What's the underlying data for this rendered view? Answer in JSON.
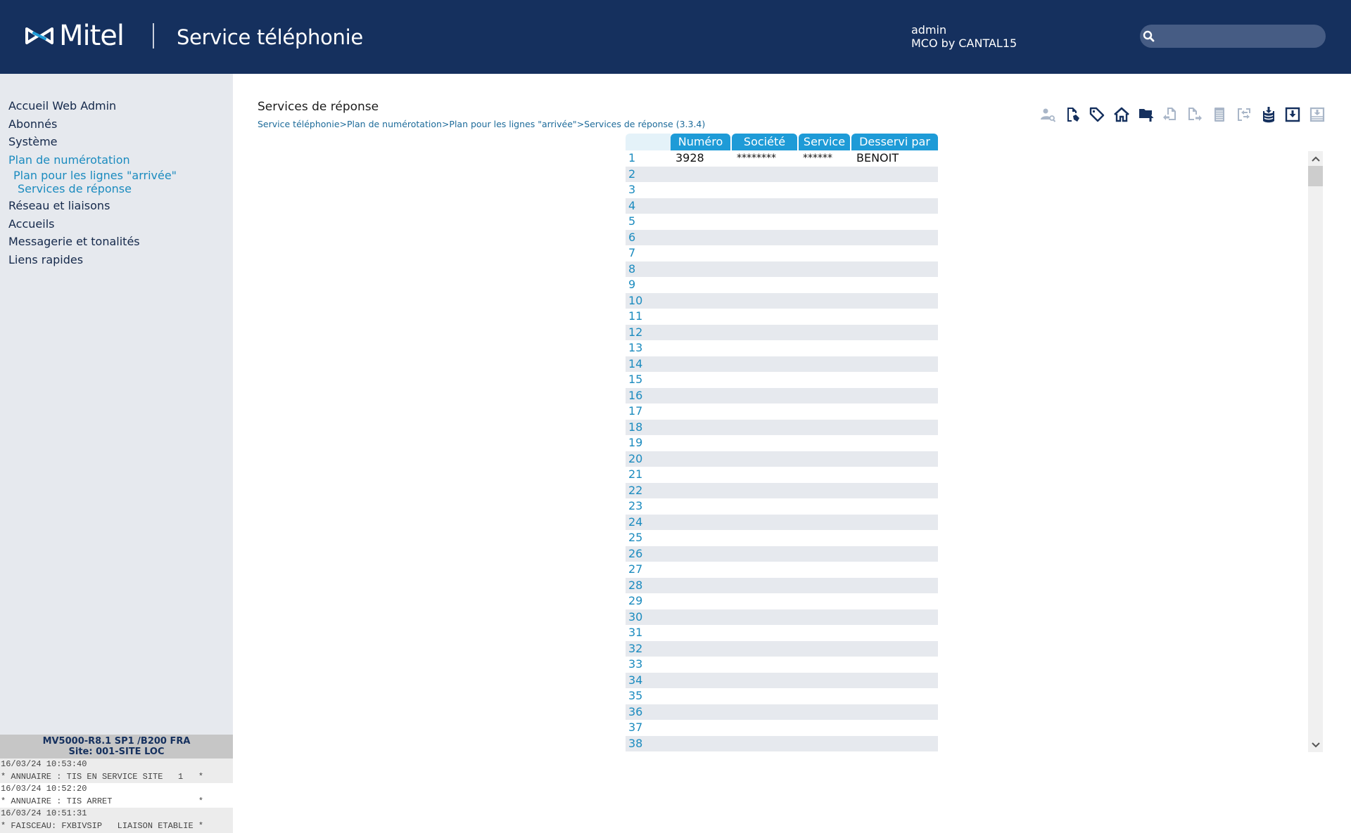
{
  "header": {
    "logo_text": "Mitel",
    "app_title": "Service téléphonie",
    "user_name": "admin",
    "user_org": "MCO by CANTAL15",
    "search_placeholder": "",
    "search_value": ""
  },
  "sidebar": {
    "items": [
      {
        "label": "Accueil Web Admin",
        "level": 0,
        "active": false
      },
      {
        "label": "Abonnés",
        "level": 0,
        "active": false
      },
      {
        "label": "Système",
        "level": 0,
        "active": false
      },
      {
        "label": "Plan de numérotation",
        "level": 0,
        "active": true
      },
      {
        "label": "Plan pour les lignes \"arrivée\"",
        "level": 1,
        "active": true
      },
      {
        "label": "Services de réponse",
        "level": 2,
        "active": true
      },
      {
        "label": "Réseau et liaisons",
        "level": 0,
        "active": false
      },
      {
        "label": "Accueils",
        "level": 0,
        "active": false
      },
      {
        "label": "Messagerie et tonalités",
        "level": 0,
        "active": false
      },
      {
        "label": "Liens rapides",
        "level": 0,
        "active": false
      }
    ],
    "status": {
      "version": "MV5000-R8.1 SP1 /B200 FRA",
      "site": "Site: 001-SITE LOC",
      "log": [
        "16/03/24 10:53:40",
        "* ANNUAIRE : TIS EN SERVICE SITE   1   *",
        "16/03/24 10:52:20",
        "* ANNUAIRE : TIS ARRET                 *",
        "16/03/24 10:51:31",
        "* FAISCEAU: FXBIVSIP   LIAISON ETABLIE *"
      ]
    }
  },
  "main": {
    "title": "Services de réponse",
    "breadcrumb": [
      "Service téléphonie",
      "Plan de numérotation",
      "Plan pour les lignes \"arrivée\"",
      "Services de réponse (3.3.4)"
    ],
    "breadcrumb_separator": ">",
    "toolbar": [
      {
        "icon": "user-search-icon",
        "enabled": false
      },
      {
        "icon": "document-edit-icon",
        "enabled": true
      },
      {
        "icon": "tag-icon",
        "enabled": true
      },
      {
        "icon": "home-icon",
        "enabled": true
      },
      {
        "icon": "folder-upload-icon",
        "enabled": true
      },
      {
        "icon": "document-import-icon",
        "enabled": false
      },
      {
        "icon": "document-export-icon",
        "enabled": false
      },
      {
        "icon": "list-icon",
        "enabled": false
      },
      {
        "icon": "swap-icon",
        "enabled": false
      },
      {
        "icon": "database-download-icon",
        "enabled": true
      },
      {
        "icon": "save-download-icon",
        "enabled": true
      },
      {
        "icon": "save-disabled-icon",
        "enabled": false
      }
    ],
    "table": {
      "columns": [
        "",
        "Numéro",
        "Société",
        "Service",
        "Desservi par"
      ],
      "rows": [
        {
          "index": "1",
          "numero": "3928",
          "societe": "********",
          "service": "******",
          "desservi": "BENOIT"
        },
        {
          "index": "2",
          "numero": "",
          "societe": "",
          "service": "",
          "desservi": ""
        },
        {
          "index": "3",
          "numero": "",
          "societe": "",
          "service": "",
          "desservi": ""
        },
        {
          "index": "4",
          "numero": "",
          "societe": "",
          "service": "",
          "desservi": ""
        },
        {
          "index": "5",
          "numero": "",
          "societe": "",
          "service": "",
          "desservi": ""
        },
        {
          "index": "6",
          "numero": "",
          "societe": "",
          "service": "",
          "desservi": ""
        },
        {
          "index": "7",
          "numero": "",
          "societe": "",
          "service": "",
          "desservi": ""
        },
        {
          "index": "8",
          "numero": "",
          "societe": "",
          "service": "",
          "desservi": ""
        },
        {
          "index": "9",
          "numero": "",
          "societe": "",
          "service": "",
          "desservi": ""
        },
        {
          "index": "10",
          "numero": "",
          "societe": "",
          "service": "",
          "desservi": ""
        },
        {
          "index": "11",
          "numero": "",
          "societe": "",
          "service": "",
          "desservi": ""
        },
        {
          "index": "12",
          "numero": "",
          "societe": "",
          "service": "",
          "desservi": ""
        },
        {
          "index": "13",
          "numero": "",
          "societe": "",
          "service": "",
          "desservi": ""
        },
        {
          "index": "14",
          "numero": "",
          "societe": "",
          "service": "",
          "desservi": ""
        },
        {
          "index": "15",
          "numero": "",
          "societe": "",
          "service": "",
          "desservi": ""
        },
        {
          "index": "16",
          "numero": "",
          "societe": "",
          "service": "",
          "desservi": ""
        },
        {
          "index": "17",
          "numero": "",
          "societe": "",
          "service": "",
          "desservi": ""
        },
        {
          "index": "18",
          "numero": "",
          "societe": "",
          "service": "",
          "desservi": ""
        },
        {
          "index": "19",
          "numero": "",
          "societe": "",
          "service": "",
          "desservi": ""
        },
        {
          "index": "20",
          "numero": "",
          "societe": "",
          "service": "",
          "desservi": ""
        },
        {
          "index": "21",
          "numero": "",
          "societe": "",
          "service": "",
          "desservi": ""
        },
        {
          "index": "22",
          "numero": "",
          "societe": "",
          "service": "",
          "desservi": ""
        },
        {
          "index": "23",
          "numero": "",
          "societe": "",
          "service": "",
          "desservi": ""
        },
        {
          "index": "24",
          "numero": "",
          "societe": "",
          "service": "",
          "desservi": ""
        },
        {
          "index": "25",
          "numero": "",
          "societe": "",
          "service": "",
          "desservi": ""
        },
        {
          "index": "26",
          "numero": "",
          "societe": "",
          "service": "",
          "desservi": ""
        },
        {
          "index": "27",
          "numero": "",
          "societe": "",
          "service": "",
          "desservi": ""
        },
        {
          "index": "28",
          "numero": "",
          "societe": "",
          "service": "",
          "desservi": ""
        },
        {
          "index": "29",
          "numero": "",
          "societe": "",
          "service": "",
          "desservi": ""
        },
        {
          "index": "30",
          "numero": "",
          "societe": "",
          "service": "",
          "desservi": ""
        },
        {
          "index": "31",
          "numero": "",
          "societe": "",
          "service": "",
          "desservi": ""
        },
        {
          "index": "32",
          "numero": "",
          "societe": "",
          "service": "",
          "desservi": ""
        },
        {
          "index": "33",
          "numero": "",
          "societe": "",
          "service": "",
          "desservi": ""
        },
        {
          "index": "34",
          "numero": "",
          "societe": "",
          "service": "",
          "desservi": ""
        },
        {
          "index": "35",
          "numero": "",
          "societe": "",
          "service": "",
          "desservi": ""
        },
        {
          "index": "36",
          "numero": "",
          "societe": "",
          "service": "",
          "desservi": ""
        },
        {
          "index": "37",
          "numero": "",
          "societe": "",
          "service": "",
          "desservi": ""
        },
        {
          "index": "38",
          "numero": "",
          "societe": "",
          "service": "",
          "desservi": ""
        }
      ]
    }
  },
  "colors": {
    "header_bg": "#15305e",
    "accent": "#1e9bd7",
    "link": "#1b8bbf",
    "sidebar_bg": "#e6e9ee",
    "icon_enabled": "#15305e",
    "icon_disabled": "#a9b6c8"
  }
}
